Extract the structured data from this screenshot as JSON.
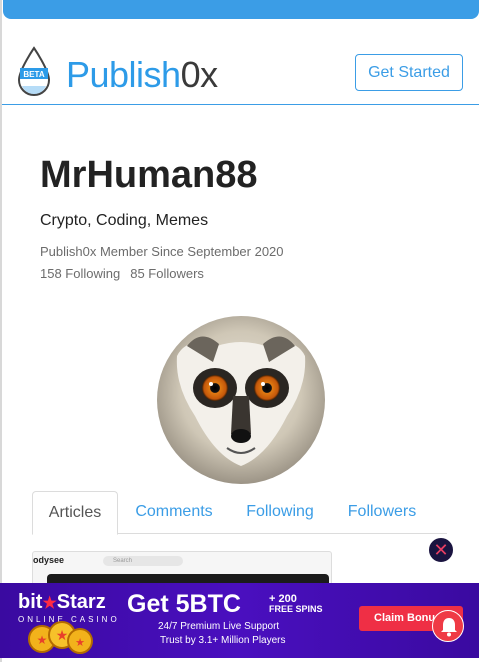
{
  "header": {
    "logo_brand": "Publish",
    "logo_suffix": "0x",
    "logo_badge": "BETA",
    "get_started_label": "Get Started"
  },
  "profile": {
    "username": "MrHuman88",
    "tagline": "Crypto, Coding, Memes",
    "member_since": "Publish0x Member Since September 2020",
    "following_count": "158 Following",
    "followers_count": "85 Followers",
    "avatar_icon": "lemur-avatar"
  },
  "tabs": [
    {
      "label": "Articles",
      "active": true
    },
    {
      "label": "Comments",
      "active": false
    },
    {
      "label": "Following",
      "active": false
    },
    {
      "label": "Followers",
      "active": false
    }
  ],
  "article_preview": {
    "site_name": "odysee",
    "search_placeholder": "Search"
  },
  "ad": {
    "brand": "bit",
    "brand_rest": "Starz",
    "brand_sub": "ONLINE CASINO",
    "headline": "Get 5BTC",
    "bonus_amount": "+ 200",
    "bonus_label": "FREE SPINS",
    "support_line": "24/7 Premium Live Support",
    "trust_line": "Trust by 3.1+ Million Players",
    "cta_label": "Claim Bonus",
    "close_icon": "close-icon"
  },
  "colors": {
    "accent": "#3b9de6",
    "ad_background": "#4a0fbf",
    "ad_cta": "#ef2f45",
    "notification": "#ef3a45"
  }
}
